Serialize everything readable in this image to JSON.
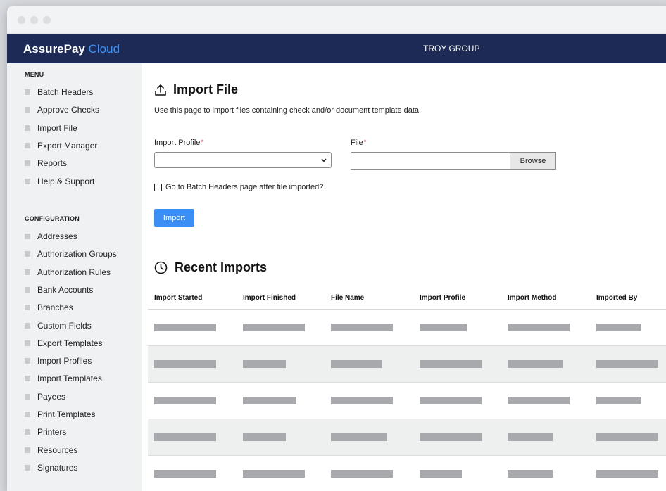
{
  "brand": {
    "name": "AssurePay",
    "suffix": "Cloud"
  },
  "org_name": "TROY GROUP",
  "sidebar": {
    "menu_title": "MENU",
    "menu_items": [
      "Batch Headers",
      "Approve Checks",
      "Import File",
      "Export Manager",
      "Reports",
      "Help & Support"
    ],
    "config_title": "CONFIGURATION",
    "config_items": [
      "Addresses",
      "Authorization Groups",
      "Authorization Rules",
      "Bank Accounts",
      "Branches",
      "Custom Fields",
      "Export Templates",
      "Import Profiles",
      "Import Templates",
      "Payees",
      "Print Templates",
      "Printers",
      "Resources",
      "Signatures"
    ]
  },
  "page": {
    "title": "Import File",
    "description": "Use this page to import files containing check and/or document template data.",
    "import_profile_label": "Import Profile",
    "file_label": "File",
    "required_mark": "*",
    "import_profile_value": "",
    "file_value": "",
    "browse_label": "Browse",
    "checkbox_label": "Go to Batch Headers page after file imported?",
    "checkbox_checked": false,
    "import_button": "Import"
  },
  "recent": {
    "title": "Recent Imports",
    "columns": [
      "Import Started",
      "Import Finished",
      "File Name",
      "Import Profile",
      "Import Method",
      "Imported By"
    ],
    "rows_shown": 5
  },
  "colors": {
    "app_bar": "#1c2a55",
    "accent": "#3b8ef5",
    "brand_cloud": "#3b95ff",
    "placeholder_bar": "#a7a9ac",
    "required": "#e0333a"
  }
}
